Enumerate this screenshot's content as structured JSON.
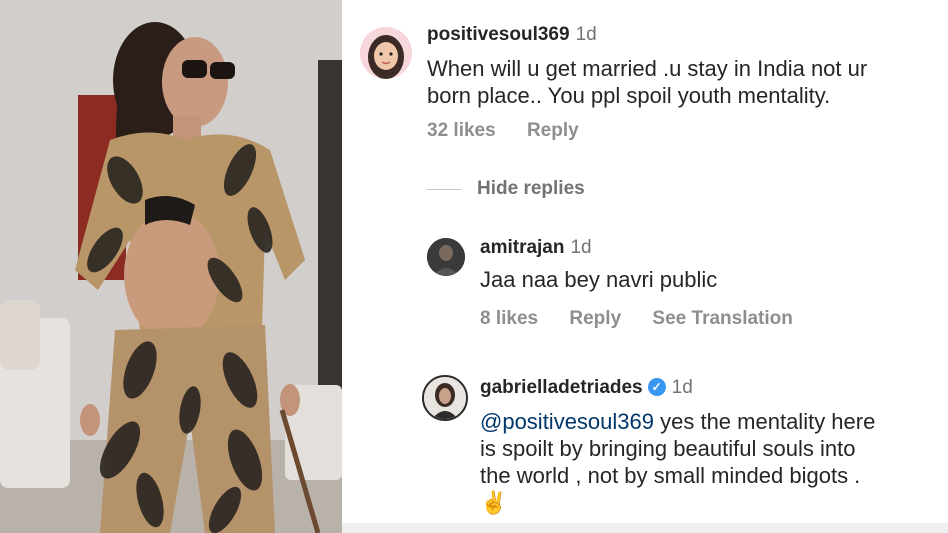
{
  "comments": [
    {
      "username": "positivesoul369",
      "time": "1d",
      "text_line1": "When will u get married .u stay in India not ur",
      "text_line2": "born place.. You ppl spoil youth mentality.",
      "likes": "32 likes",
      "reply": "Reply",
      "avatar_icon": "avatar-girl-icon"
    }
  ],
  "hide_replies": "Hide replies",
  "replies": [
    {
      "username": "amitrajan",
      "time": "1d",
      "text": "Jaa naa bey navri public",
      "likes": "8 likes",
      "reply": "Reply",
      "translate": "See Translation",
      "avatar_icon": "avatar-dark-icon"
    },
    {
      "username": "gabrielladetriades",
      "time": "1d",
      "verified": true,
      "mention": "@positivesoul369",
      "text_line1": " yes the mentality here",
      "text_line2": "is spoilt by bringing beautiful souls into",
      "text_line3": "the world , not by small minded bigots .",
      "text_line4": "✌",
      "avatar_icon": "avatar-woman-icon"
    }
  ],
  "colors": {
    "mention": "#00376b",
    "verified": "#3897f0",
    "muted": "#8e8e8e"
  }
}
